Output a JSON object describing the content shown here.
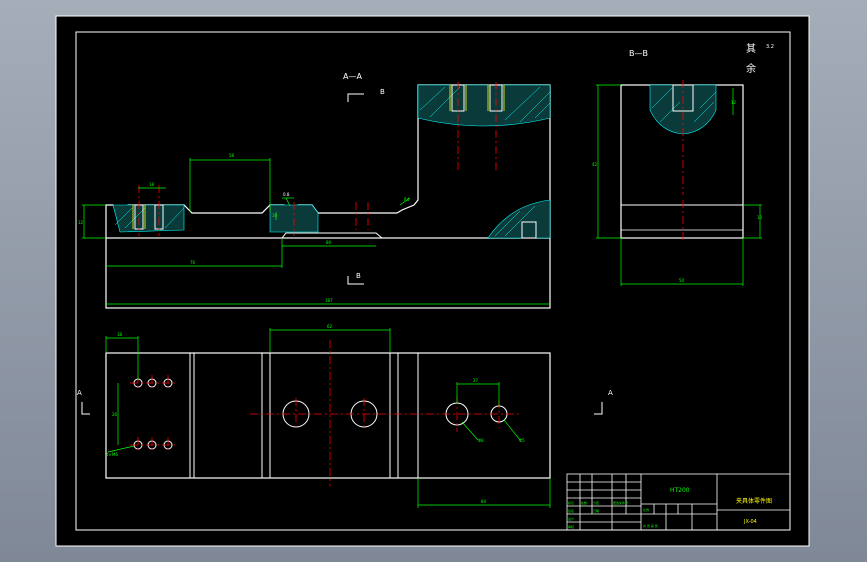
{
  "viewport": {
    "background": "#8e97a6",
    "sheet_color": "#000000"
  },
  "colors": {
    "outline": "#ffffff",
    "dimension": "#00ff00",
    "centerline": "#ff0000",
    "hatch": "#00ffff",
    "thread": "#ffff00"
  },
  "sections": {
    "aa_label": "A—A",
    "bb_label": "B—B",
    "b_marker_top": "B",
    "b_marker_bottom": "B",
    "a_marker_left": "A",
    "a_marker_right": "A"
  },
  "dimensions": {
    "d_top_width": "58",
    "d_left_small": "18",
    "d_left_height": "12",
    "d_mid_small": "10",
    "d_chamfer": "0.8",
    "d_radius": "R4",
    "d_bottom_span": "76",
    "d_mid_span": "80",
    "d_total_length": "187",
    "d_bb_height": "42",
    "d_bb_bottom_h": "10",
    "d_bb_width": "50",
    "d_bb_top_r": "12",
    "d_plan_width": "62",
    "d_plan_left": "18",
    "d_plan_offset": "26",
    "d_plan_hole_small": "27",
    "d_plan_right": "84",
    "d_hole_big": "Φ8",
    "d_hole_small": "Φ5",
    "d_thread_note": "4×M6"
  },
  "roughness": {
    "symbol": "其",
    "note": "余",
    "value": "3.2"
  },
  "title_block": {
    "material": "HT200",
    "part_name": "夹具体零件图",
    "drawing_no": "JX-04",
    "designer_label": "设计",
    "scale_label": "比例",
    "approved_label": "审核",
    "sheet_label": "共 张 第 张",
    "rows": [
      "标记",
      "处数",
      "分区",
      "更改文件号",
      "签名",
      "日期"
    ]
  }
}
